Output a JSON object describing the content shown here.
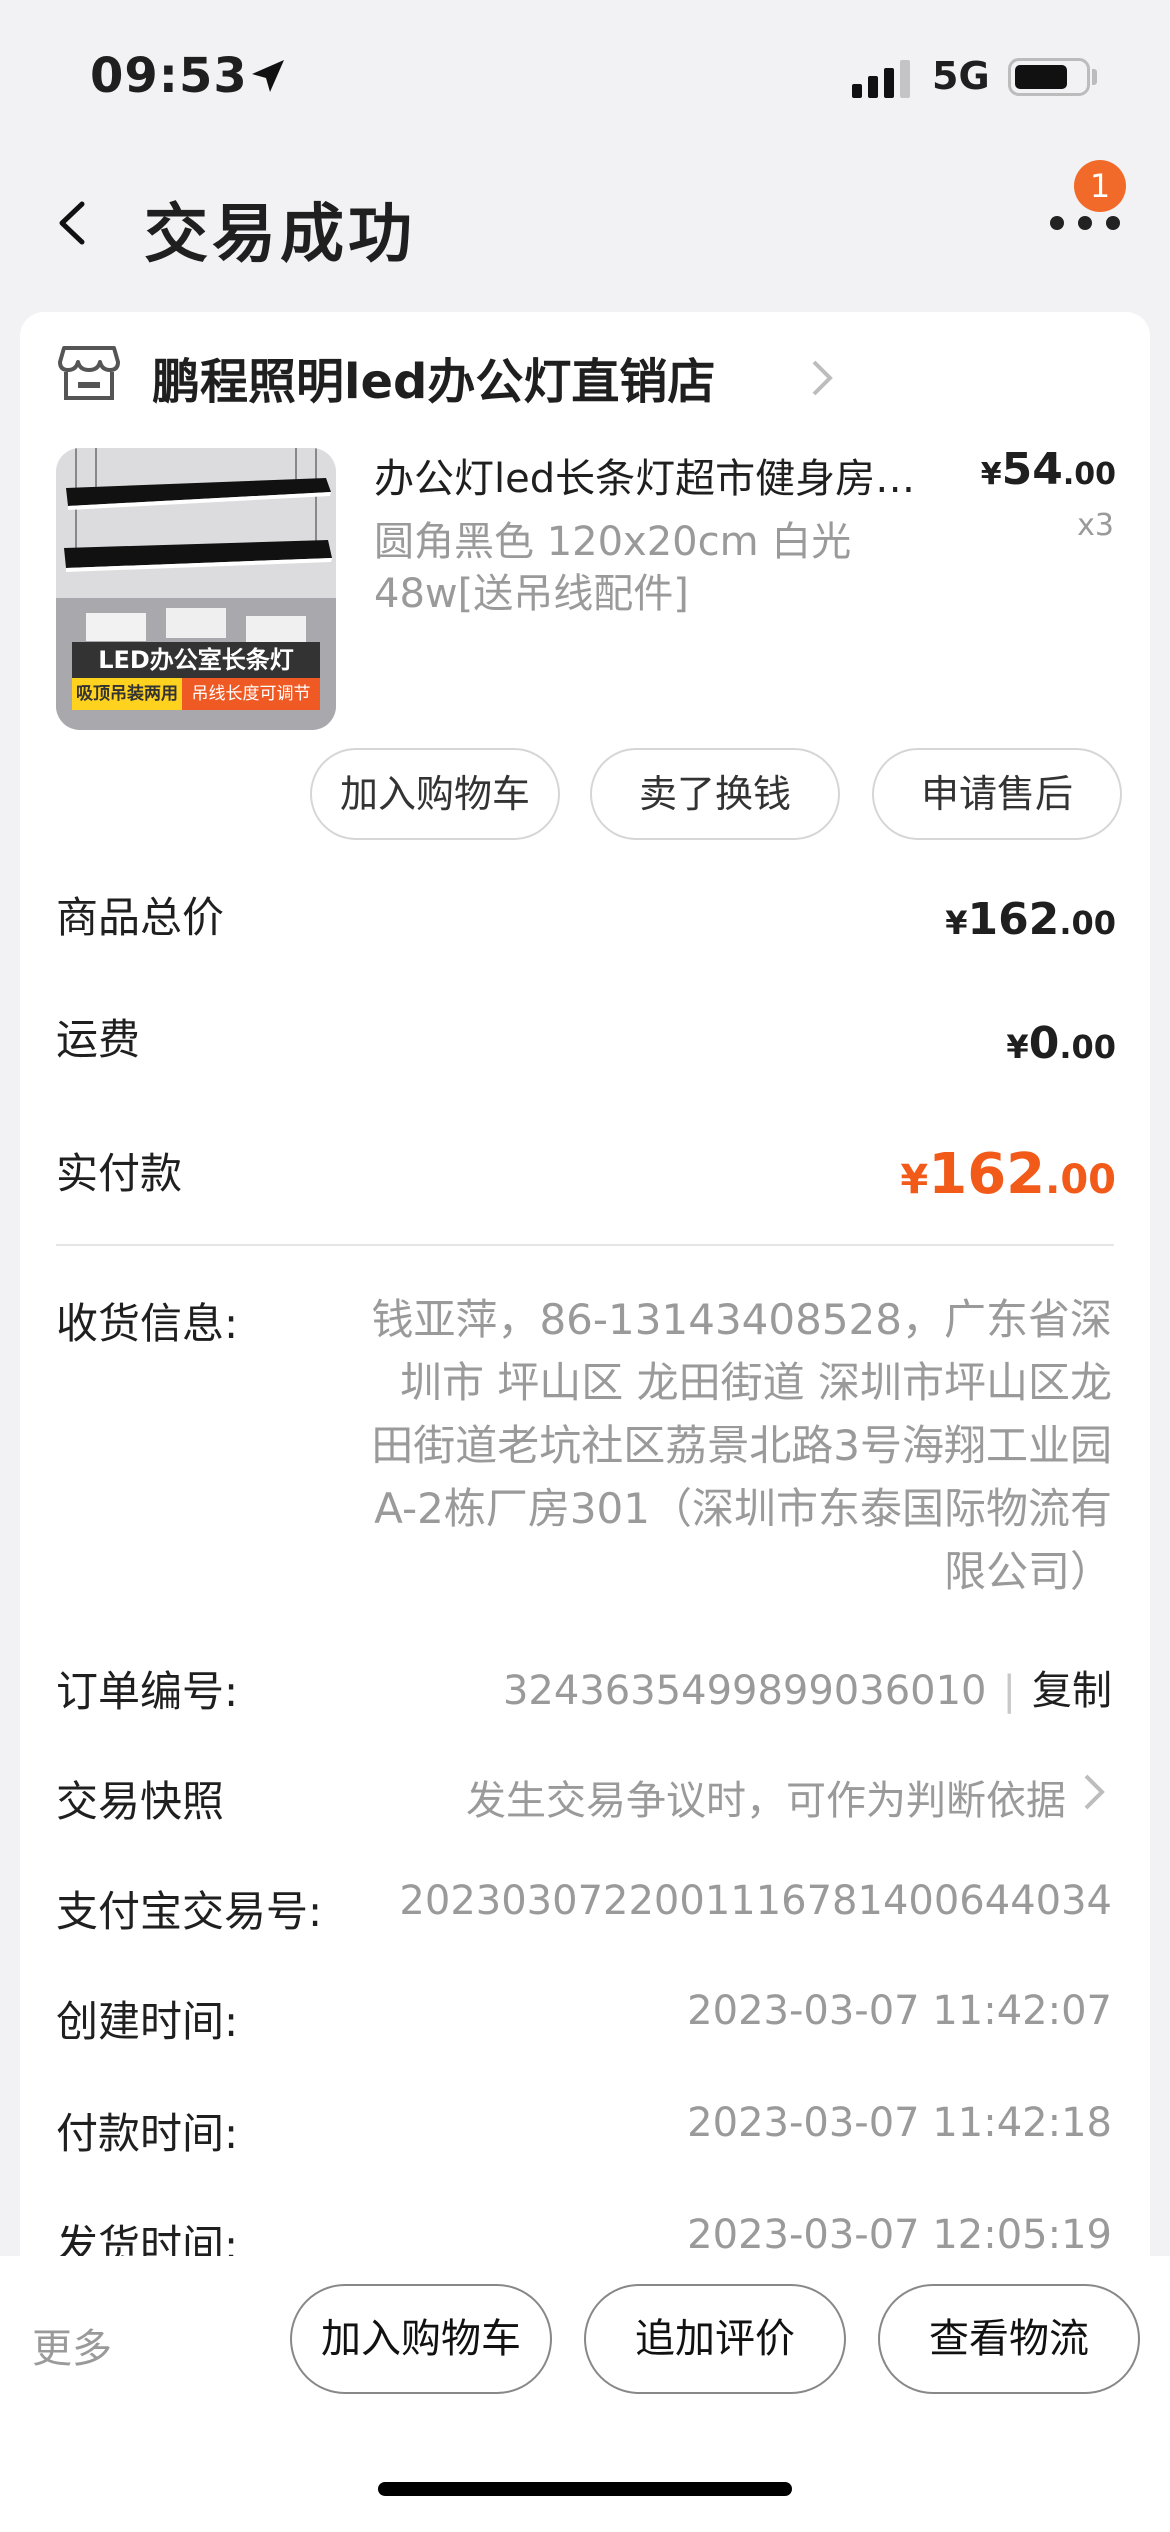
{
  "status_bar": {
    "time": "09:53",
    "network": "5G"
  },
  "nav": {
    "title": "交易成功",
    "badge_count": "1"
  },
  "shop": {
    "name": "鹏程照明led办公灯直销店"
  },
  "product": {
    "title": "办公灯led长条灯超市健身房商用吊灯",
    "sku": "圆角黑色 120x20cm 白光48w[送吊线配件]",
    "price_currency": "¥",
    "price_int": "54",
    "price_dec": ".00",
    "quantity": "x3",
    "image_banner": "LED办公室长条灯",
    "image_tag1": "吸顶吊装两用",
    "image_tag2": "吊线长度可调节"
  },
  "item_actions": [
    "加入购物车",
    "卖了换钱",
    "申请售后"
  ],
  "totals": {
    "goods_label": "商品总价",
    "goods_int": "162",
    "goods_dec": ".00",
    "shipping_label": "运费",
    "shipping_int": "0",
    "shipping_dec": ".00",
    "paid_label": "实付款",
    "paid_int": "162",
    "paid_dec": ".00",
    "currency": "¥"
  },
  "order_info": {
    "address_label": "收货信息:",
    "address": "钱亚萍，86-13143408528，广东省深圳市 坪山区 龙田街道 深圳市坪山区龙田街道老坑社区荔景北路3号海翔工业园A-2栋厂房301（深圳市东泰国际物流有限公司）",
    "order_no_label": "订单编号:",
    "order_no": "3243635499899036010",
    "copy_label": "复制",
    "snapshot_label": "交易快照",
    "snapshot_text": "发生交易争议时，可作为判断依据",
    "alipay_label": "支付宝交易号:",
    "alipay_no": "2023030722001116781400644034",
    "created_label": "创建时间:",
    "created": "2023-03-07 11:42:07",
    "paid_time_label": "付款时间:",
    "paid_time": "2023-03-07 11:42:18",
    "shipped_label": "发货时间:",
    "shipped": "2023-03-07 12:05:19"
  },
  "bottom_bar": {
    "more": "更多",
    "buttons": [
      "加入购物车",
      "追加评价",
      "查看物流"
    ]
  },
  "colors": {
    "accent": "#f25a1a",
    "badge": "#f26a2a"
  }
}
